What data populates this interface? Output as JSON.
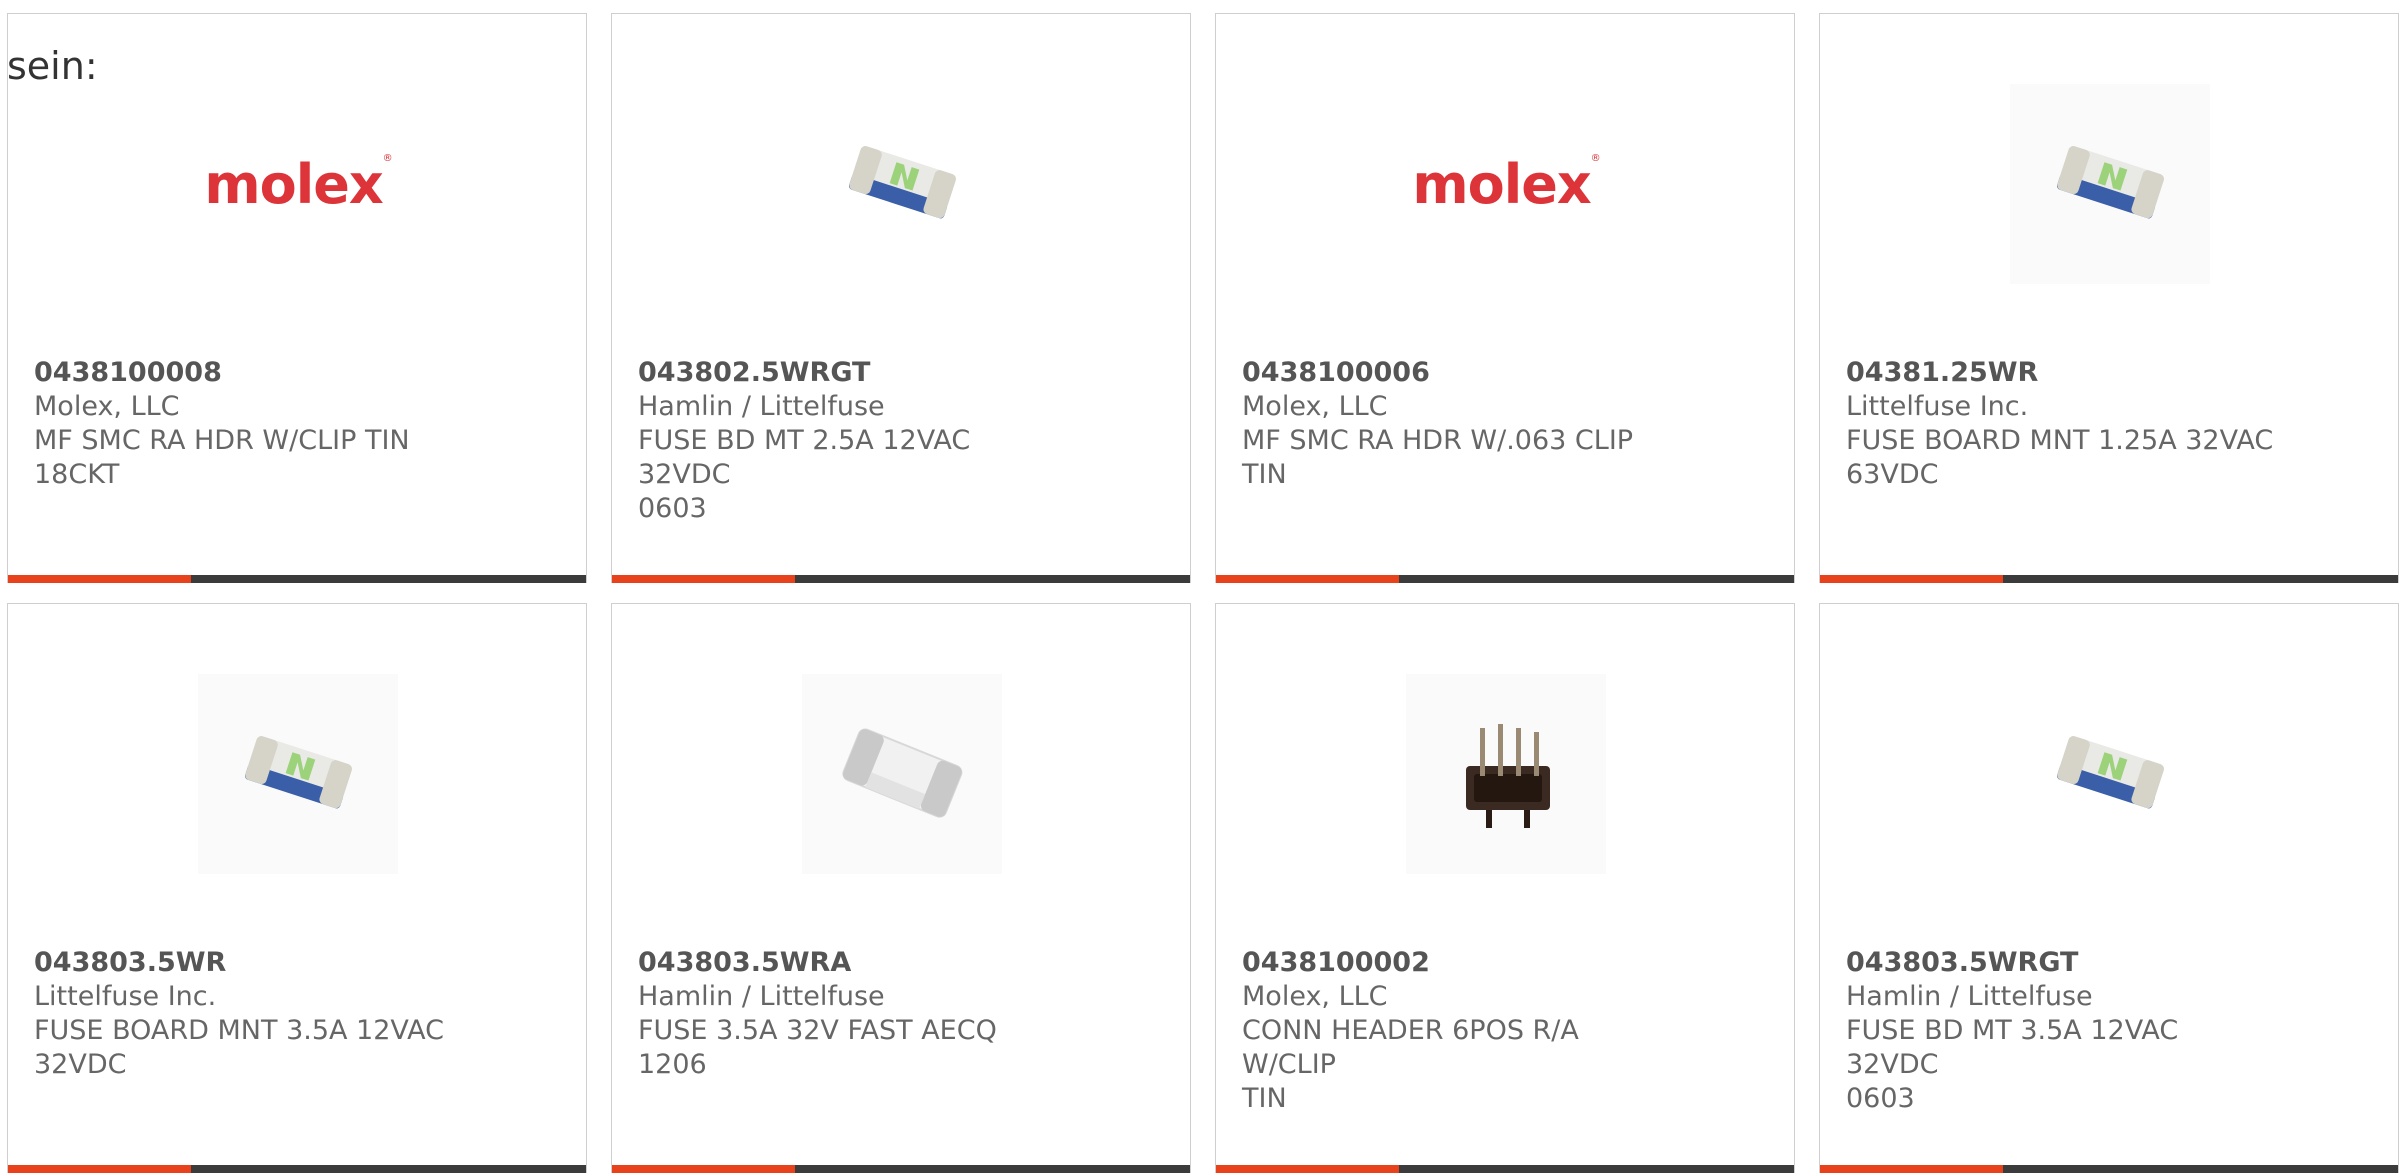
{
  "lead_text": "sein:",
  "colors": {
    "accent": "#e8421c",
    "bar": "#3b3b3b",
    "brand_molex": "#dc3439"
  },
  "products": [
    {
      "part_number": "0438100008",
      "manufacturer": "Molex, LLC",
      "description_line1": "MF SMC RA HDR W/CLIP TIN",
      "description_line2": "18CKT",
      "image": "molex-logo"
    },
    {
      "part_number": "043802.5WRGT",
      "manufacturer": "Hamlin / Littelfuse",
      "description_line1": "FUSE BD MT 2.5A 12VAC 32VDC",
      "description_line2": "0603",
      "image": "smd-fuse-green"
    },
    {
      "part_number": "0438100006",
      "manufacturer": "Molex, LLC",
      "description_line1": "MF SMC RA HDR W/.063 CLIP",
      "description_line2": "TIN",
      "image": "molex-logo"
    },
    {
      "part_number": "04381.25WR",
      "manufacturer": "Littelfuse Inc.",
      "description_line1": "FUSE BOARD MNT 1.25A 32VAC",
      "description_line2": "63VDC",
      "image": "smd-fuse-green"
    },
    {
      "part_number": "043803.5WR",
      "manufacturer": "Littelfuse Inc.",
      "description_line1": "FUSE BOARD MNT 3.5A 12VAC",
      "description_line2": "32VDC",
      "image": "smd-fuse-green"
    },
    {
      "part_number": "043803.5WRA",
      "manufacturer": "Hamlin / Littelfuse",
      "description_line1": "FUSE 3.5A 32V FAST AECQ 1206",
      "description_line2": "",
      "image": "smd-fuse-white"
    },
    {
      "part_number": "0438100002",
      "manufacturer": "Molex, LLC",
      "description_line1": "CONN HEADER 6POS R/A W/CLIP",
      "description_line2": "TIN",
      "image": "pin-header"
    },
    {
      "part_number": "043803.5WRGT",
      "manufacturer": "Hamlin / Littelfuse",
      "description_line1": "FUSE BD MT 3.5A 12VAC 32VDC",
      "description_line2": "0603",
      "image": "smd-fuse-green"
    }
  ],
  "brand_text": "molex"
}
